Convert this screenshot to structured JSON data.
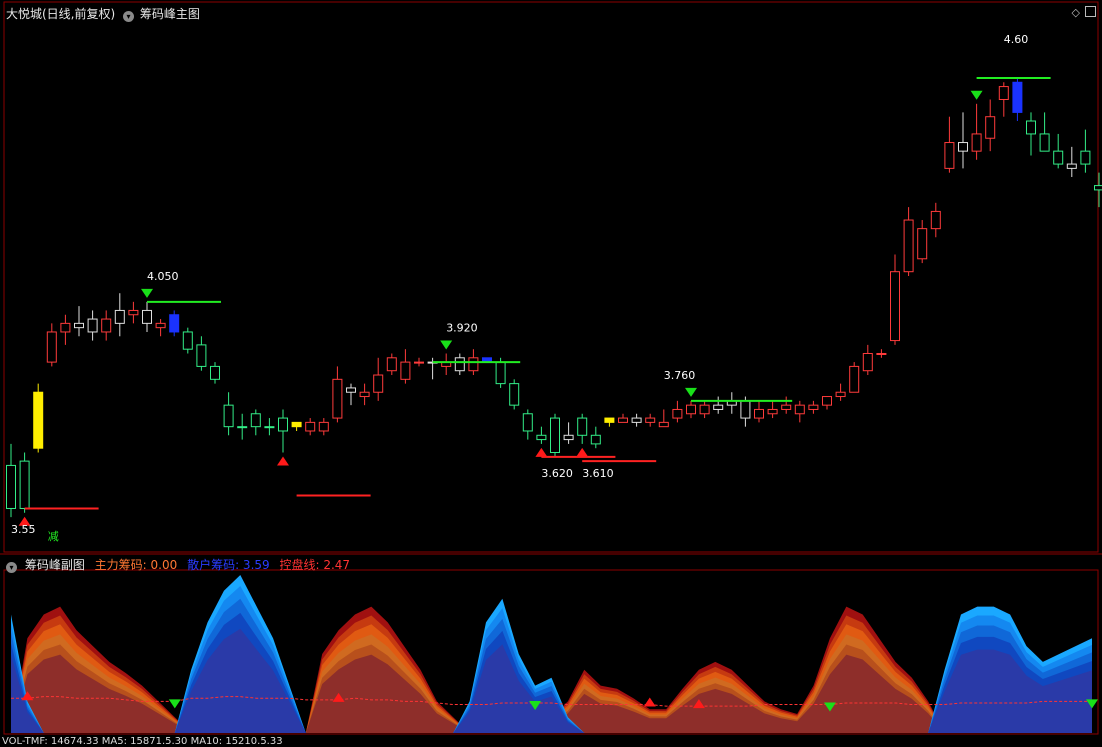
{
  "header": {
    "stock_title": "大悦城(日线,前复权)",
    "main_indicator": "筹码峰主图",
    "sub_indicator": "筹码峰副图",
    "legend": [
      {
        "label": "主力筹码: 0.00",
        "color": "#ff7733"
      },
      {
        "label": "散户筹码: 3.59",
        "color": "#2a3cff"
      },
      {
        "label": "控盘线: 2.47",
        "color": "#ff3333"
      }
    ],
    "footer_text": "VOL-TMF: 14674.33  MA5: 15871.5.30  MA10: 15210.5.33"
  },
  "colors": {
    "up": "#ff3b3b",
    "down": "#33ee88",
    "neutral": "#e0e0e0",
    "highlight_yellow": "#ffee00",
    "highlight_blue": "#1a33ff",
    "sell_marker": "#19e019",
    "buy_marker": "#ff1a1a",
    "panel_border": "#8b0000"
  },
  "chart_data": [
    {
      "type": "candlestick",
      "title": "筹码峰主图",
      "ylim": [
        3.52,
        4.7
      ],
      "candles": [
        {
          "o": 3.57,
          "h": 3.72,
          "l": 3.55,
          "c": 3.67,
          "k": "down"
        },
        {
          "o": 3.57,
          "h": 3.7,
          "l": 3.56,
          "c": 3.68,
          "k": "down"
        },
        {
          "o": 3.71,
          "h": 3.86,
          "l": 3.7,
          "c": 3.84,
          "k": "yellow"
        },
        {
          "o": 3.91,
          "h": 4.0,
          "l": 3.9,
          "c": 3.98,
          "k": "up"
        },
        {
          "o": 3.98,
          "h": 4.02,
          "l": 3.95,
          "c": 4.0,
          "k": "up"
        },
        {
          "o": 3.99,
          "h": 4.04,
          "l": 3.97,
          "c": 4.0,
          "k": "neutral"
        },
        {
          "o": 3.98,
          "h": 4.03,
          "l": 3.96,
          "c": 4.01,
          "k": "neutral"
        },
        {
          "o": 3.98,
          "h": 4.03,
          "l": 3.96,
          "c": 4.01,
          "k": "up"
        },
        {
          "o": 4.0,
          "h": 4.07,
          "l": 3.97,
          "c": 4.03,
          "k": "neutral"
        },
        {
          "o": 4.02,
          "h": 4.05,
          "l": 4.0,
          "c": 4.03,
          "k": "up"
        },
        {
          "o": 4.03,
          "h": 4.05,
          "l": 3.98,
          "c": 4.0,
          "k": "neutral"
        },
        {
          "o": 3.99,
          "h": 4.01,
          "l": 3.97,
          "c": 4.0,
          "k": "up"
        },
        {
          "o": 4.02,
          "h": 4.03,
          "l": 3.97,
          "c": 3.98,
          "k": "blue"
        },
        {
          "o": 3.98,
          "h": 3.99,
          "l": 3.93,
          "c": 3.94,
          "k": "down"
        },
        {
          "o": 3.95,
          "h": 3.97,
          "l": 3.89,
          "c": 3.9,
          "k": "down"
        },
        {
          "o": 3.9,
          "h": 3.91,
          "l": 3.86,
          "c": 3.87,
          "k": "down"
        },
        {
          "o": 3.81,
          "h": 3.84,
          "l": 3.74,
          "c": 3.76,
          "k": "down"
        },
        {
          "o": 3.76,
          "h": 3.79,
          "l": 3.73,
          "c": 3.76,
          "k": "down"
        },
        {
          "o": 3.76,
          "h": 3.8,
          "l": 3.74,
          "c": 3.79,
          "k": "down"
        },
        {
          "o": 3.76,
          "h": 3.78,
          "l": 3.74,
          "c": 3.76,
          "k": "down"
        },
        {
          "o": 3.78,
          "h": 3.8,
          "l": 3.7,
          "c": 3.75,
          "k": "down"
        },
        {
          "o": 3.76,
          "h": 3.77,
          "l": 3.75,
          "c": 3.77,
          "k": "yellow"
        },
        {
          "o": 3.75,
          "h": 3.78,
          "l": 3.74,
          "c": 3.77,
          "k": "up"
        },
        {
          "o": 3.75,
          "h": 3.78,
          "l": 3.74,
          "c": 3.77,
          "k": "up"
        },
        {
          "o": 3.78,
          "h": 3.9,
          "l": 3.77,
          "c": 3.87,
          "k": "up"
        },
        {
          "o": 3.84,
          "h": 3.86,
          "l": 3.81,
          "c": 3.85,
          "k": "neutral"
        },
        {
          "o": 3.83,
          "h": 3.86,
          "l": 3.81,
          "c": 3.84,
          "k": "up"
        },
        {
          "o": 3.84,
          "h": 3.92,
          "l": 3.82,
          "c": 3.88,
          "k": "up"
        },
        {
          "o": 3.89,
          "h": 3.93,
          "l": 3.88,
          "c": 3.92,
          "k": "up"
        },
        {
          "o": 3.87,
          "h": 3.94,
          "l": 3.86,
          "c": 3.91,
          "k": "up"
        },
        {
          "o": 3.91,
          "h": 3.92,
          "l": 3.9,
          "c": 3.91,
          "k": "up"
        },
        {
          "o": 3.91,
          "h": 3.92,
          "l": 3.87,
          "c": 3.91,
          "k": "neutral"
        },
        {
          "o": 3.9,
          "h": 3.93,
          "l": 3.88,
          "c": 3.91,
          "k": "up"
        },
        {
          "o": 3.89,
          "h": 3.93,
          "l": 3.88,
          "c": 3.92,
          "k": "neutral"
        },
        {
          "o": 3.89,
          "h": 3.94,
          "l": 3.88,
          "c": 3.92,
          "k": "up"
        },
        {
          "o": 3.92,
          "h": 3.92,
          "l": 3.91,
          "c": 3.91,
          "k": "blue"
        },
        {
          "o": 3.91,
          "h": 3.92,
          "l": 3.85,
          "c": 3.86,
          "k": "down"
        },
        {
          "o": 3.86,
          "h": 3.87,
          "l": 3.8,
          "c": 3.81,
          "k": "down"
        },
        {
          "o": 3.79,
          "h": 3.8,
          "l": 3.73,
          "c": 3.75,
          "k": "down"
        },
        {
          "o": 3.74,
          "h": 3.76,
          "l": 3.72,
          "c": 3.73,
          "k": "down"
        },
        {
          "o": 3.7,
          "h": 3.79,
          "l": 3.69,
          "c": 3.78,
          "k": "down"
        },
        {
          "o": 3.73,
          "h": 3.77,
          "l": 3.72,
          "c": 3.74,
          "k": "neutral"
        },
        {
          "o": 3.74,
          "h": 3.79,
          "l": 3.72,
          "c": 3.78,
          "k": "down"
        },
        {
          "o": 3.72,
          "h": 3.76,
          "l": 3.71,
          "c": 3.74,
          "k": "down"
        },
        {
          "o": 3.77,
          "h": 3.78,
          "l": 3.76,
          "c": 3.78,
          "k": "yellow"
        },
        {
          "o": 3.77,
          "h": 3.79,
          "l": 3.77,
          "c": 3.78,
          "k": "up"
        },
        {
          "o": 3.77,
          "h": 3.79,
          "l": 3.76,
          "c": 3.78,
          "k": "neutral"
        },
        {
          "o": 3.77,
          "h": 3.79,
          "l": 3.76,
          "c": 3.78,
          "k": "up"
        },
        {
          "o": 3.76,
          "h": 3.8,
          "l": 3.76,
          "c": 3.77,
          "k": "up"
        },
        {
          "o": 3.78,
          "h": 3.82,
          "l": 3.77,
          "c": 3.8,
          "k": "up"
        },
        {
          "o": 3.79,
          "h": 3.82,
          "l": 3.78,
          "c": 3.81,
          "k": "up"
        },
        {
          "o": 3.79,
          "h": 3.82,
          "l": 3.78,
          "c": 3.81,
          "k": "up"
        },
        {
          "o": 3.8,
          "h": 3.83,
          "l": 3.79,
          "c": 3.81,
          "k": "neutral"
        },
        {
          "o": 3.81,
          "h": 3.84,
          "l": 3.79,
          "c": 3.82,
          "k": "neutral"
        },
        {
          "o": 3.82,
          "h": 3.83,
          "l": 3.76,
          "c": 3.78,
          "k": "neutral"
        },
        {
          "o": 3.78,
          "h": 3.82,
          "l": 3.77,
          "c": 3.8,
          "k": "up"
        },
        {
          "o": 3.79,
          "h": 3.82,
          "l": 3.78,
          "c": 3.8,
          "k": "up"
        },
        {
          "o": 3.8,
          "h": 3.83,
          "l": 3.79,
          "c": 3.81,
          "k": "up"
        },
        {
          "o": 3.79,
          "h": 3.82,
          "l": 3.77,
          "c": 3.81,
          "k": "up"
        },
        {
          "o": 3.8,
          "h": 3.82,
          "l": 3.79,
          "c": 3.81,
          "k": "up"
        },
        {
          "o": 3.81,
          "h": 3.83,
          "l": 3.8,
          "c": 3.83,
          "k": "up"
        },
        {
          "o": 3.83,
          "h": 3.86,
          "l": 3.82,
          "c": 3.84,
          "k": "up"
        },
        {
          "o": 3.84,
          "h": 3.91,
          "l": 3.84,
          "c": 3.9,
          "k": "up"
        },
        {
          "o": 3.89,
          "h": 3.95,
          "l": 3.88,
          "c": 3.93,
          "k": "up"
        },
        {
          "o": 3.93,
          "h": 3.94,
          "l": 3.92,
          "c": 3.93,
          "k": "up"
        },
        {
          "o": 3.96,
          "h": 4.16,
          "l": 3.95,
          "c": 4.12,
          "k": "up"
        },
        {
          "o": 4.12,
          "h": 4.27,
          "l": 4.11,
          "c": 4.24,
          "k": "up"
        },
        {
          "o": 4.15,
          "h": 4.24,
          "l": 4.14,
          "c": 4.22,
          "k": "up"
        },
        {
          "o": 4.22,
          "h": 4.28,
          "l": 4.2,
          "c": 4.26,
          "k": "up"
        },
        {
          "o": 4.36,
          "h": 4.48,
          "l": 4.35,
          "c": 4.42,
          "k": "up"
        },
        {
          "o": 4.4,
          "h": 4.49,
          "l": 4.36,
          "c": 4.42,
          "k": "neutral"
        },
        {
          "o": 4.4,
          "h": 4.51,
          "l": 4.38,
          "c": 4.44,
          "k": "up"
        },
        {
          "o": 4.43,
          "h": 4.52,
          "l": 4.4,
          "c": 4.48,
          "k": "up"
        },
        {
          "o": 4.52,
          "h": 4.56,
          "l": 4.48,
          "c": 4.55,
          "k": "up"
        },
        {
          "o": 4.56,
          "h": 4.57,
          "l": 4.47,
          "c": 4.49,
          "k": "blue"
        },
        {
          "o": 4.47,
          "h": 4.49,
          "l": 4.39,
          "c": 4.44,
          "k": "down"
        },
        {
          "o": 4.44,
          "h": 4.49,
          "l": 4.4,
          "c": 4.4,
          "k": "down"
        },
        {
          "o": 4.4,
          "h": 4.44,
          "l": 4.36,
          "c": 4.37,
          "k": "down"
        },
        {
          "o": 4.37,
          "h": 4.41,
          "l": 4.34,
          "c": 4.36,
          "k": "neutral"
        },
        {
          "o": 4.37,
          "h": 4.45,
          "l": 4.35,
          "c": 4.4,
          "k": "down"
        },
        {
          "o": 4.31,
          "h": 4.35,
          "l": 4.27,
          "c": 4.32,
          "k": "down"
        },
        {
          "o": 4.32,
          "h": 4.35,
          "l": 4.28,
          "c": 4.33,
          "k": "neutral"
        },
        {
          "o": 4.35,
          "h": 4.37,
          "l": 4.29,
          "c": 4.32,
          "k": "down"
        },
        {
          "o": 4.31,
          "h": 4.34,
          "l": 4.26,
          "c": 4.28,
          "k": "down"
        },
        {
          "o": 4.27,
          "h": 4.3,
          "l": 4.23,
          "c": 4.24,
          "k": "down"
        }
      ],
      "annotations": [
        {
          "text": "4.050",
          "role": "peak",
          "candle": 10,
          "y": 4.05
        },
        {
          "text": "3.920",
          "role": "peak",
          "candle": 32,
          "y": 3.93
        },
        {
          "text": "3.760",
          "role": "peak",
          "candle": 48,
          "y": 3.82
        },
        {
          "text": "4.60",
          "role": "peak",
          "candle": 73,
          "y": 4.6
        },
        {
          "text": "3.55",
          "role": "low",
          "candle": 0,
          "y": 3.55
        },
        {
          "text": "3.620",
          "role": "low",
          "candle": 39,
          "y": 3.68
        },
        {
          "text": "3.610",
          "role": "low",
          "candle": 42,
          "y": 3.68
        },
        {
          "text": "减",
          "role": "tag",
          "candle": 3,
          "y": 3.52
        }
      ],
      "sell_signals": [
        10,
        32,
        50,
        71
      ],
      "buy_signals": [
        1,
        20,
        39,
        42
      ],
      "resistance_lines": [
        {
          "from": 10,
          "to": 15,
          "y": 4.05
        },
        {
          "from": 31,
          "to": 37,
          "y": 3.91
        },
        {
          "from": 50,
          "to": 57,
          "y": 3.82
        },
        {
          "from": 71,
          "to": 76,
          "y": 4.57
        }
      ],
      "support_lines": [
        {
          "from": 1,
          "to": 6,
          "y": 3.57
        },
        {
          "from": 21,
          "to": 26,
          "y": 3.6
        },
        {
          "from": 39,
          "to": 44,
          "y": 3.69
        },
        {
          "from": 42,
          "to": 47,
          "y": 3.68
        }
      ]
    },
    {
      "type": "area",
      "title": "筹码峰副图",
      "ylim": [
        0,
        1
      ],
      "series_names": [
        "主力筹码",
        "散户筹码",
        "控盘线"
      ],
      "main_force": [
        0,
        0.6,
        0.75,
        0.8,
        0.65,
        0.55,
        0.45,
        0.38,
        0.3,
        0.2,
        0.1,
        0,
        0,
        0,
        0,
        0,
        0,
        0,
        0,
        0.5,
        0.65,
        0.75,
        0.8,
        0.7,
        0.55,
        0.4,
        0.2,
        0.1,
        0,
        0,
        0,
        0,
        0.05,
        0.1,
        0.2,
        0.4,
        0.3,
        0.28,
        0.22,
        0.15,
        0.15,
        0.28,
        0.4,
        0.45,
        0.4,
        0.3,
        0.2,
        0.15,
        0.12,
        0.3,
        0.6,
        0.8,
        0.75,
        0.6,
        0.45,
        0.35,
        0.2,
        0,
        0,
        0,
        0,
        0,
        0,
        0,
        0,
        0,
        0
      ],
      "retail": [
        0.75,
        0.2,
        0,
        0,
        0,
        0,
        0,
        0,
        0,
        0,
        0,
        0.4,
        0.7,
        0.9,
        1.0,
        0.8,
        0.6,
        0.3,
        0,
        0,
        0,
        0,
        0,
        0,
        0,
        0,
        0,
        0,
        0.2,
        0.7,
        0.85,
        0.5,
        0.3,
        0.35,
        0.1,
        0,
        0,
        0,
        0,
        0,
        0,
        0,
        0,
        0,
        0,
        0,
        0,
        0,
        0,
        0,
        0,
        0,
        0,
        0,
        0,
        0,
        0,
        0.4,
        0.75,
        0.8,
        0.8,
        0.75,
        0.55,
        0.45,
        0.5,
        0.55,
        0.6
      ],
      "control_line": [
        0.22,
        0.22,
        0.23,
        0.23,
        0.22,
        0.22,
        0.22,
        0.21,
        0.2,
        0.2,
        0.2,
        0.22,
        0.22,
        0.23,
        0.23,
        0.22,
        0.22,
        0.22,
        0.21,
        0.21,
        0.21,
        0.22,
        0.21,
        0.21,
        0.2,
        0.2,
        0.19,
        0.18,
        0.18,
        0.18,
        0.19,
        0.19,
        0.19,
        0.19,
        0.18,
        0.18,
        0.18,
        0.18,
        0.18,
        0.18,
        0.17,
        0.17,
        0.17,
        0.17,
        0.17,
        0.17,
        0.18,
        0.18,
        0.18,
        0.18,
        0.18,
        0.19,
        0.19,
        0.19,
        0.19,
        0.18,
        0.18,
        0.18,
        0.19,
        0.19,
        0.19,
        0.19,
        0.19,
        0.2,
        0.2,
        0.2,
        0.2
      ],
      "sell_signals": [
        10,
        32,
        50,
        66
      ],
      "buy_signals": [
        1,
        20,
        39,
        42
      ]
    }
  ]
}
